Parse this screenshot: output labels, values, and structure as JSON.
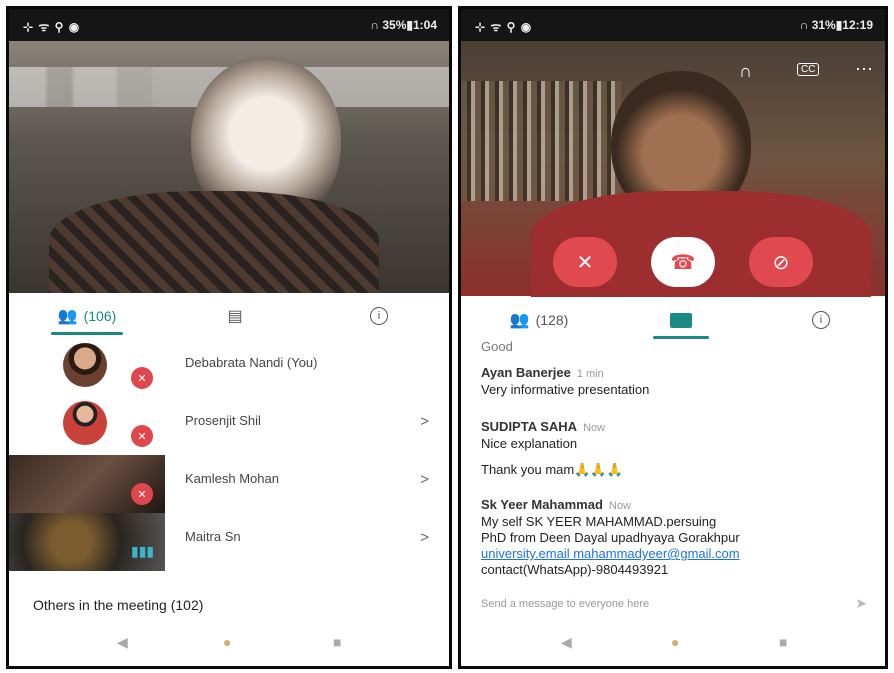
{
  "left": {
    "status": {
      "icons": "⊹ ᯤ ⚲ ◉",
      "right": "∩ 35%▮1:04"
    },
    "tabs": {
      "people_label": "(106)",
      "people_icon": "people-icon",
      "chat_icon": "chat-icon",
      "info_icon": "info-icon"
    },
    "participants": [
      {
        "name": "Debabrata Nandi (You)",
        "muted": true,
        "chevron": ""
      },
      {
        "name": "Prosenjit Shil",
        "muted": true,
        "chevron": ">"
      },
      {
        "name": "Kamlesh Mohan",
        "muted": true,
        "chevron": ">"
      },
      {
        "name": "Maitra Sn",
        "muted": false,
        "chevron": ">"
      }
    ],
    "others": "Others in the meeting (102)",
    "nav": {
      "back": "◀",
      "home": "●",
      "recents": "■"
    }
  },
  "right": {
    "status": {
      "icons": "⊹ ᯤ ⚲ ◉",
      "right": "∩ 31%▮12:19"
    },
    "top_icons": {
      "audio": "headphones-icon",
      "cc": "CC",
      "more": "⋯"
    },
    "controls": {
      "mic": "mic-off-icon",
      "end": "end-call-icon",
      "cam": "camera-off-icon"
    },
    "tabs": {
      "people_label": "(128)"
    },
    "messages": [
      {
        "text": "Good"
      },
      {
        "sender": "Ayan Banerjee",
        "time": "1 min",
        "lines": [
          "Very informative presentation"
        ]
      },
      {
        "sender": "SUDIPTA SAHA",
        "time": "Now",
        "lines": [
          "Nice explanation",
          "Thank you mam🙏🙏🙏"
        ]
      },
      {
        "sender": "Sk Yeer Mahammad",
        "time": "Now",
        "lines": [
          "My self SK YEER MAHAMMAD.persuing",
          "PhD from Deen Dayal upadhyaya Gorakhpur"
        ],
        "link_line": "university.email mahammadyeer@gmail.com",
        "after": "contact(WhatsApp)-9804493921"
      }
    ],
    "send_placeholder": "Send a message to everyone here",
    "nav": {
      "back": "◀",
      "home": "●",
      "recents": "■"
    }
  },
  "colors": {
    "accent": "#1a8a83",
    "muted": "#e0474d",
    "end_call": "#ffffff"
  }
}
